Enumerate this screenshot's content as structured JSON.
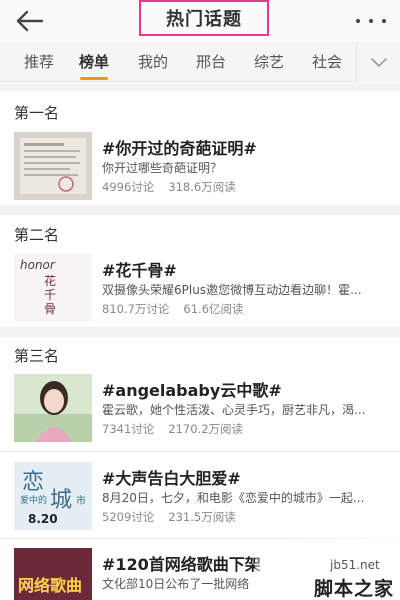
{
  "header": {
    "title": "热门话题"
  },
  "tabs": [
    {
      "label": "推荐",
      "active": false
    },
    {
      "label": "榜单",
      "active": true
    },
    {
      "label": "我的",
      "active": false
    },
    {
      "label": "邢台",
      "active": false
    },
    {
      "label": "综艺",
      "active": false
    },
    {
      "label": "社会",
      "active": false
    }
  ],
  "sections": [
    {
      "heading": "第一名"
    },
    {
      "heading": "第二名"
    },
    {
      "heading": "第三名"
    }
  ],
  "topics": [
    {
      "title": "#你开过的奇葩证明#",
      "desc": "你开过哪些奇葩证明？",
      "discussions": "4996讨论",
      "reads": "318.6万阅读"
    },
    {
      "title": "#花千骨#",
      "desc": "双摄像头荣耀6Plus邀您微博互动边看边聊！霍...",
      "discussions": "810.7万讨论",
      "reads": "61.6亿阅读",
      "thumb_brand": "honor",
      "thumb_calligraphy": "花千骨"
    },
    {
      "title": "#angelababy云中歌#",
      "desc": "霍云歌，她个性活泼、心灵手巧，厨艺非凡，渴...",
      "discussions": "7341讨论",
      "reads": "2170.2万阅读"
    },
    {
      "title": "#大声告白大胆爱#",
      "desc": "8月20日，七夕，和电影《恋爱中的城市》一起...",
      "discussions": "5209讨论",
      "reads": "231.5万阅读",
      "thumb_text_big1": "恋",
      "thumb_text_small": "爱中的",
      "thumb_text_big2": "城",
      "thumb_text_small2": "市",
      "thumb_date": "8.20"
    },
    {
      "title": "#120首网络歌曲下架",
      "desc": "文化部10日公布了一批网络",
      "thumb_text": "网络歌曲"
    }
  ],
  "watermark": {
    "url": "jb51.net",
    "logo": "脚本之家"
  },
  "colors": {
    "accent": "#f39800",
    "title_border": "#e8388a",
    "tab_bg": "#f5f5f5"
  },
  "icons": {
    "back": "back-arrow-icon",
    "more": "more-dots-icon",
    "expand": "chevron-down-icon"
  }
}
